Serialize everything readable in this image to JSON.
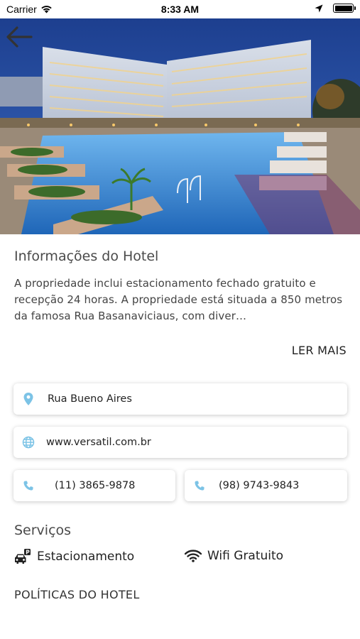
{
  "status_bar": {
    "carrier": "Carrier",
    "time": "8:33 AM"
  },
  "hero": {
    "image_subject": "hotel with illuminated pool at night"
  },
  "hotel_info": {
    "title": "Informações do Hotel",
    "description": "A propriedade inclui estacionamento fechado gratuito e recepção 24 horas. A propriedade está situada a 850 metros da famosa Rua Basanaviciaus, com diver…",
    "read_more_label": "LER MAIS"
  },
  "contact": {
    "address": "Rua Bueno Aires",
    "website": "www.versatil.com.br",
    "phone_1": "(11) 3865-9878",
    "phone_2": "(98) 9743-9843"
  },
  "services": {
    "title": "Serviços",
    "items": [
      {
        "label": "Estacionamento",
        "icon": "parking-car-icon"
      },
      {
        "label": "Wifi Gratuito",
        "icon": "wifi-icon"
      }
    ]
  },
  "policies_label": "POLÍTICAS DO HOTEL",
  "colors": {
    "accent_icon": "#7cc3e6",
    "text_primary": "#222222",
    "text_secondary": "#4a4a4a"
  }
}
